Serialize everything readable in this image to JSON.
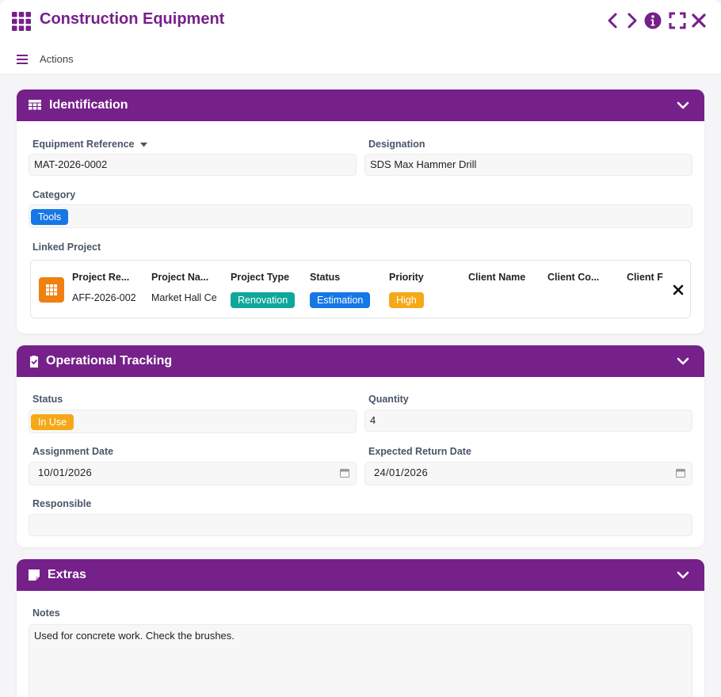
{
  "app": {
    "title": "Construction Equipment"
  },
  "toolbar": {
    "actions_label": "Actions"
  },
  "sections": {
    "identification": {
      "title": "Identification",
      "equipment_reference_label": "Equipment Reference",
      "equipment_reference_value": "MAT-2026-0002",
      "designation_label": "Designation",
      "designation_value": "SDS Max Hammer Drill",
      "category_label": "Category",
      "category_value": "Tools",
      "linked_project_label": "Linked Project",
      "linked_project": {
        "columns": [
          "Project Re...",
          "Project Na...",
          "Project Type",
          "Status",
          "Priority",
          "Client Name",
          "Client Co...",
          "Client F"
        ],
        "project_reference": "AFF-2026-002",
        "project_name": "Market Hall Ce",
        "project_type": "Renovation",
        "status": "Estimation",
        "priority": "High"
      }
    },
    "operational": {
      "title": "Operational Tracking",
      "status_label": "Status",
      "status_value": "In Use",
      "quantity_label": "Quantity",
      "quantity_value": "4",
      "assignment_date_label": "Assignment Date",
      "assignment_date_value": "10/01/2026",
      "expected_return_label": "Expected Return Date",
      "expected_return_value": "24/01/2026",
      "responsible_label": "Responsible",
      "responsible_value": ""
    },
    "extras": {
      "title": "Extras",
      "notes_label": "Notes",
      "notes_value": "Used for concrete work. Check the brushes."
    }
  },
  "colors": {
    "brand": "#76208a",
    "tag_blue": "#1677e6",
    "tag_teal": "#0fa79c",
    "tag_amber": "#f5a818",
    "project_icon": "#f0800f"
  },
  "icons": {
    "app": "grid-icon",
    "prev": "chevron-left-icon",
    "next": "chevron-right-icon",
    "info": "info-icon",
    "fullscreen": "fullscreen-icon",
    "close": "close-icon",
    "menu": "hamburger-icon",
    "identification": "table-icon",
    "operational": "clipboard-check-icon",
    "extras": "sticky-note-icon"
  }
}
